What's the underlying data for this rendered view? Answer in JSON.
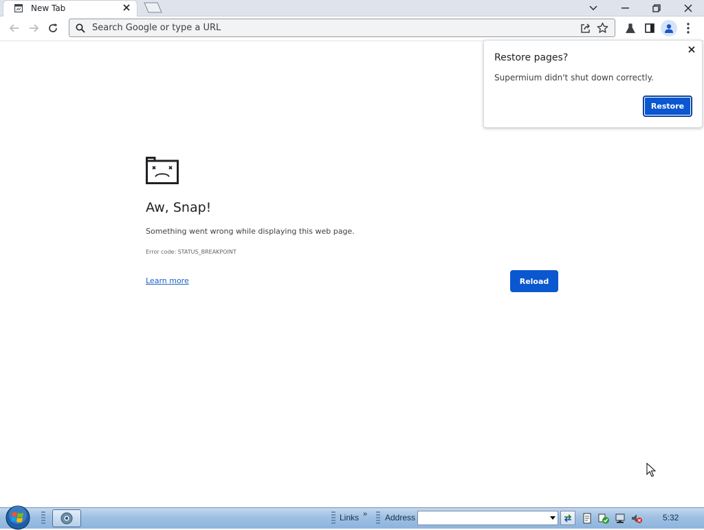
{
  "browser": {
    "tab": {
      "title": "New Tab"
    },
    "omnibox": {
      "placeholder": "Search Google or type a URL"
    }
  },
  "error_page": {
    "heading": "Aw, Snap!",
    "message": "Something went wrong while displaying this web page.",
    "error_code": "Error code: STATUS_BREAKPOINT",
    "learn_more": "Learn more",
    "reload_label": "Reload"
  },
  "restore_popup": {
    "title": "Restore pages?",
    "body": "Supermium didn't shut down correctly.",
    "button_label": "Restore"
  },
  "taskbar": {
    "links_label": "Links",
    "chevron": "»",
    "address_label": "Address",
    "address_value": "",
    "clock": "5:32"
  },
  "colors": {
    "accent": "#0b57d0",
    "tabstrip": "#dee3ec",
    "link": "#1a62c0"
  },
  "icons": [
    "page-icon",
    "close-icon",
    "new-tab-icon",
    "chevron-down-icon",
    "minimize-icon",
    "restore-icon",
    "back-arrow-icon",
    "forward-arrow-icon",
    "reload-icon",
    "search-icon",
    "share-icon",
    "star-icon",
    "lab-flask-icon",
    "side-panel-icon",
    "profile-icon",
    "menu-dots-icon",
    "sad-tab-icon",
    "windows-start-icon",
    "supermium-app-icon",
    "go-arrows-icon",
    "volume-muted-icon",
    "network-icon",
    "security-icon",
    "document-icon"
  ]
}
